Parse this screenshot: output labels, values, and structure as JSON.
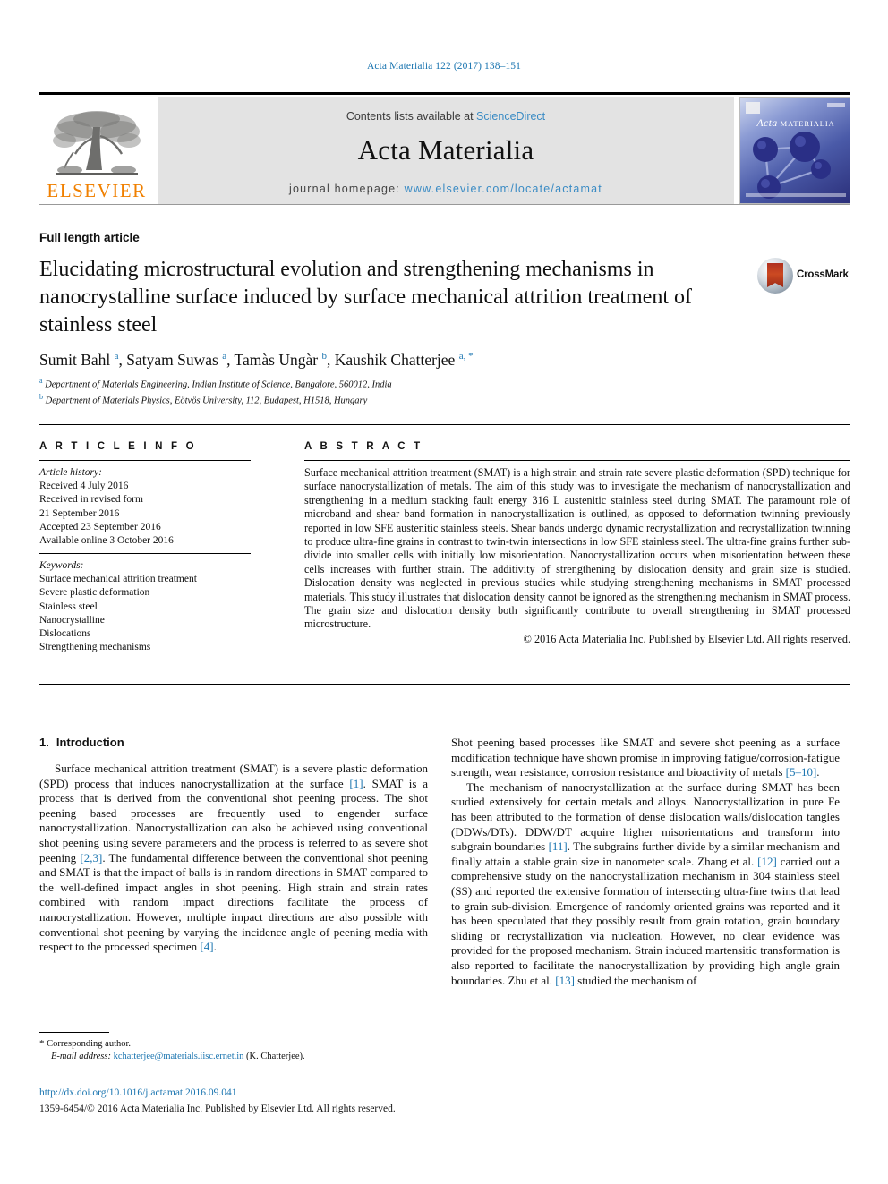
{
  "running_head": "Acta Materialia 122 (2017) 138–151",
  "masthead": {
    "publisher_name": "ELSEVIER",
    "contents_prefix": "Contents lists available at ",
    "contents_link": "ScienceDirect",
    "journal_title": "Acta Materialia",
    "homepage_prefix": "journal homepage: ",
    "homepage_url": "www.elsevier.com/locate/actamat",
    "cover_title_italic": "Acta",
    "cover_title_small": "MATERIALIA",
    "link_color": "#3a8bc4"
  },
  "article": {
    "type": "Full length article",
    "title": "Elucidating microstructural evolution and strengthening mechanisms in nanocrystalline surface induced by surface mechanical attrition treatment of stainless steel",
    "crossmark_label": "CrossMark",
    "authors_html": "Sumit Bahl <sup>a</sup>, Satyam Suwas <sup>a</sup>, Tamàs Ungàr <sup>b</sup>, Kaushik Chatterjee <sup>a, *</sup>",
    "affiliations": [
      {
        "mark": "a",
        "text": "Department of Materials Engineering, Indian Institute of Science, Bangalore, 560012, India"
      },
      {
        "mark": "b",
        "text": "Department of Materials Physics, Eötvös University, 112, Budapest, H1518, Hungary"
      }
    ]
  },
  "info": {
    "heading": "A R T I C L E   I N F O",
    "history_label": "Article history:",
    "history": [
      "Received 4 July 2016",
      "Received in revised form",
      "21 September 2016",
      "Accepted 23 September 2016",
      "Available online 3 October 2016"
    ],
    "keywords_label": "Keywords:",
    "keywords": [
      "Surface mechanical attrition treatment",
      "Severe plastic deformation",
      "Stainless steel",
      "Nanocrystalline",
      "Dislocations",
      "Strengthening mechanisms"
    ]
  },
  "abstract": {
    "heading": "A B S T R A C T",
    "text": "Surface mechanical attrition treatment (SMAT) is a high strain and strain rate severe plastic deformation (SPD) technique for surface nanocrystallization of metals. The aim of this study was to investigate the mechanism of nanocrystallization and strengthening in a medium stacking fault energy 316 L austenitic stainless steel during SMAT. The paramount role of microband and shear band formation in nanocrystallization is outlined, as opposed to deformation twinning previously reported in low SFE austenitic stainless steels. Shear bands undergo dynamic recrystallization and recrystallization twinning to produce ultra-fine grains in contrast to twin-twin intersections in low SFE stainless steel. The ultra-fine grains further sub-divide into smaller cells with initially low misorientation. Nanocrystallization occurs when misorientation between these cells increases with further strain. The additivity of strengthening by dislocation density and grain size is studied. Dislocation density was neglected in previous studies while studying strengthening mechanisms in SMAT processed materials. This study illustrates that dislocation density cannot be ignored as the strengthening mechanism in SMAT process. The grain size and dislocation density both significantly contribute to overall strengthening in SMAT processed microstructure.",
    "copyright": "© 2016 Acta Materialia Inc. Published by Elsevier Ltd. All rights reserved."
  },
  "body": {
    "section_number": "1.",
    "section_title": "Introduction",
    "left_paragraph_1_parts": [
      "Surface mechanical attrition treatment (SMAT) is a severe plastic deformation (SPD) process that induces nanocrystallization at the surface ",
      "[1]",
      ". SMAT is a process that is derived from the conventional shot peening process. The shot peening based processes are frequently used to engender surface nanocrystallization. Nanocrystallization can also be achieved using conventional shot peening using severe parameters and the process is referred to as severe shot peening ",
      "[2,3]",
      ". The fundamental difference between the conventional shot peening and SMAT is that the impact of balls is in random directions in SMAT compared to the well-defined impact angles in shot peening. High strain and strain rates combined with random impact directions facilitate the process of nanocrystallization. However, multiple impact directions are also possible with conventional shot peening by varying the incidence angle of peening media with respect to the processed specimen ",
      "[4]",
      "."
    ],
    "right_paragraph_1_parts": [
      "Shot peening based processes like SMAT and severe shot peening as a surface modification technique have shown promise in improving fatigue/corrosion-fatigue strength, wear resistance, corrosion resistance and bioactivity of metals ",
      "[5–10]",
      "."
    ],
    "right_paragraph_2_parts": [
      "The mechanism of nanocrystallization at the surface during SMAT has been studied extensively for certain metals and alloys. Nanocrystallization in pure Fe has been attributed to the formation of dense dislocation walls/dislocation tangles (DDWs/DTs). DDW/DT acquire higher misorientations and transform into subgrain boundaries ",
      "[11]",
      ". The subgrains further divide by a similar mechanism and finally attain a stable grain size in nanometer scale. Zhang et al. ",
      "[12]",
      " carried out a comprehensive study on the nanocrystallization mechanism in 304 stainless steel (SS) and reported the extensive formation of intersecting ultra-fine twins that lead to grain sub-division. Emergence of randomly oriented grains was reported and it has been speculated that they possibly result from grain rotation, grain boundary sliding or recrystallization via nucleation. However, no clear evidence was provided for the proposed mechanism. Strain induced martensitic transformation is also reported to facilitate the nanocrystallization by providing high angle grain boundaries. Zhu et al. ",
      "[13]",
      " studied the mechanism of"
    ]
  },
  "footnote": {
    "star": "*",
    "corresponding": "Corresponding author.",
    "email_label": "E-mail address:",
    "email": "kchatterjee@materials.iisc.ernet.in",
    "email_suffix": "(K. Chatterjee)."
  },
  "footer": {
    "doi": "http://dx.doi.org/10.1016/j.actamat.2016.09.041",
    "issn_line": "1359-6454/© 2016 Acta Materialia Inc. Published by Elsevier Ltd. All rights reserved."
  }
}
